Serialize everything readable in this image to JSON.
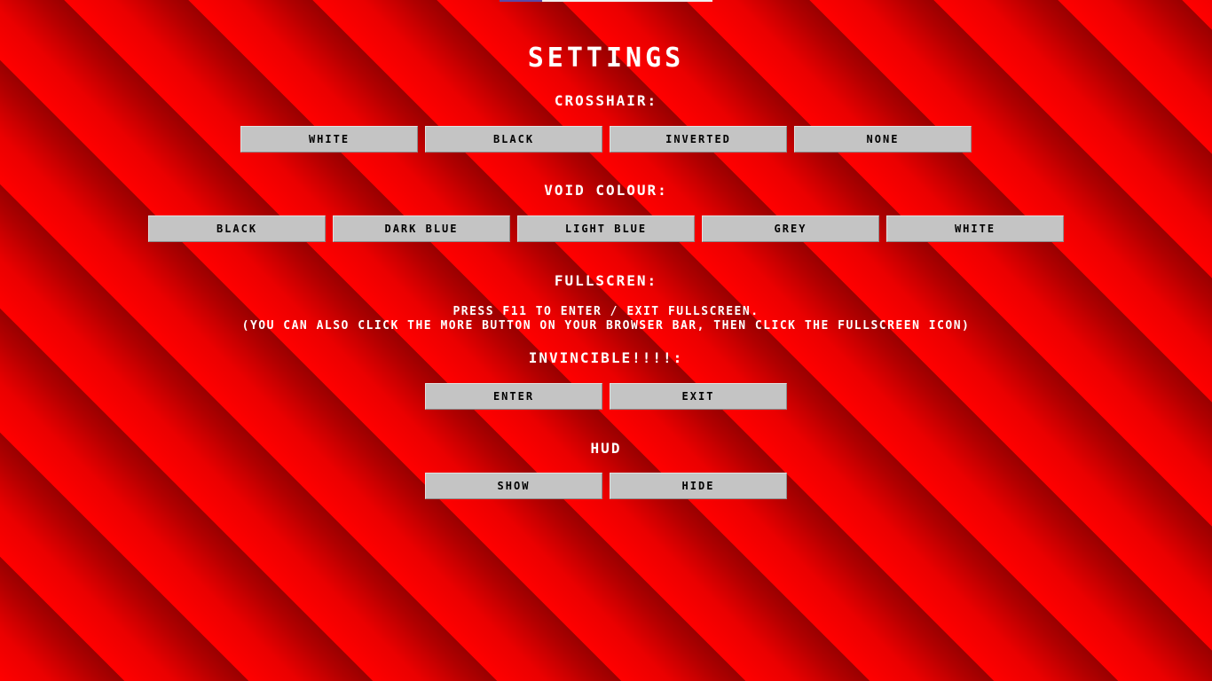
{
  "title": "SETTINGS",
  "crosshair": {
    "heading": "CROSSHAIR:",
    "options": [
      "WHITE",
      "BLACK",
      "INVERTED",
      "NONE"
    ]
  },
  "void_colour": {
    "heading": "VOID COLOUR:",
    "options": [
      "BLACK",
      "DARK BLUE",
      "LIGHT BLUE",
      "GREY",
      "WHITE"
    ]
  },
  "fullscreen": {
    "heading": "FULLSCREN:",
    "line1": "PRESS F11 TO ENTER / EXIT FULLSCREEN.",
    "line2": "(YOU CAN ALSO CLICK THE MORE BUTTON ON YOUR BROWSER BAR, THEN CLICK THE FULLSCREEN ICON)"
  },
  "invincible": {
    "heading": "INVINCIBLE!!!!:",
    "options": [
      "ENTER",
      "EXIT"
    ]
  },
  "hud": {
    "heading": "HUD",
    "options": [
      "SHOW",
      "HIDE"
    ]
  },
  "colors": {
    "background_light": "#ff0000",
    "background_dark": "#990000",
    "button_face": "#c4c4c4",
    "text": "#ffffff"
  }
}
